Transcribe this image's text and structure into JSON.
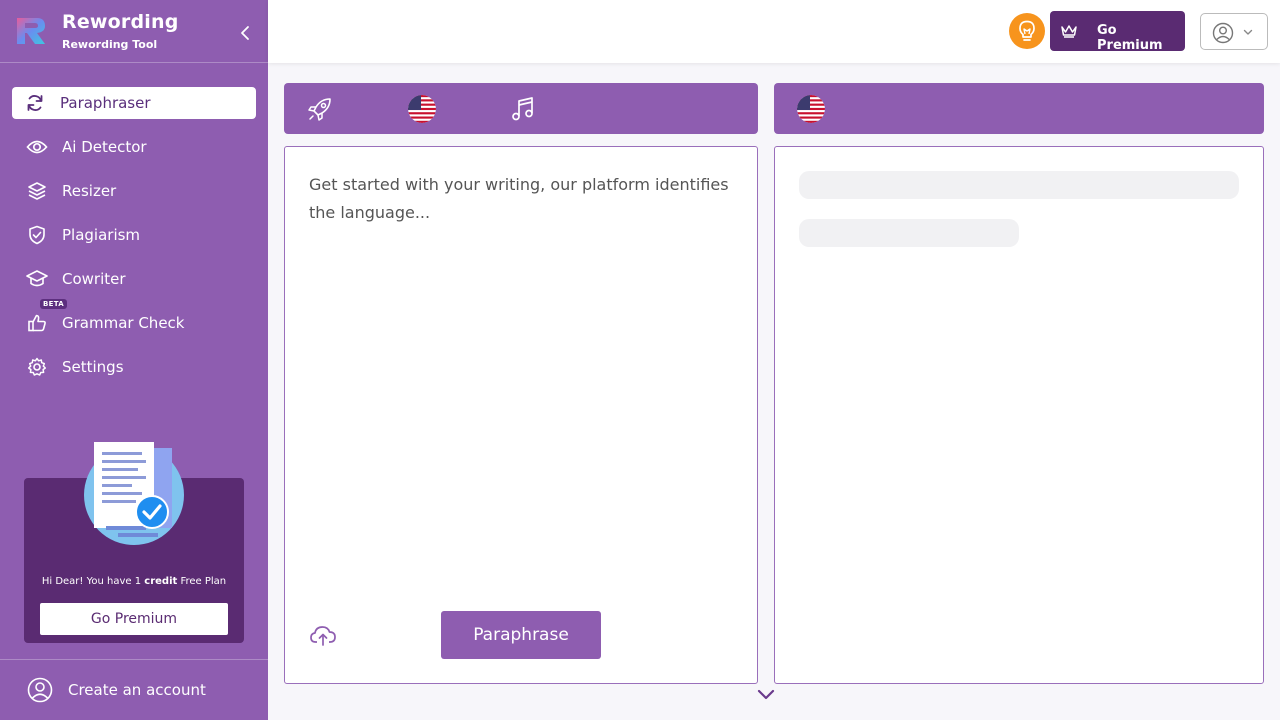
{
  "brand": {
    "title": "Rewording",
    "subtitle": "Rewording Tool"
  },
  "sidebar": {
    "items": [
      {
        "label": "Paraphraser",
        "icon": "refresh-icon",
        "active": true
      },
      {
        "label": "Ai Detector",
        "icon": "eye-icon"
      },
      {
        "label": "Resizer",
        "icon": "layers-icon"
      },
      {
        "label": "Plagiarism",
        "icon": "shield-check-icon"
      },
      {
        "label": "Cowriter",
        "icon": "graduation-cap-icon"
      },
      {
        "label": "Grammar Check",
        "icon": "thumbs-up-icon",
        "badge": "BETA"
      },
      {
        "label": "Settings",
        "icon": "gear-icon"
      }
    ],
    "promo": {
      "message_prefix": "Hi Dear! You have 1 ",
      "message_bold": "credit",
      "message_suffix": " Free Plan",
      "button": "Go Premium"
    },
    "account_label": "Create an account"
  },
  "header": {
    "premium_label": "Go Premium"
  },
  "editor": {
    "placeholder": "Get started with your writing, our platform identifies the language...",
    "paraphrase_button": "Paraphrase"
  },
  "colors": {
    "primary": "#8e5db0",
    "dark": "#5a2b72",
    "accent": "#f7941d"
  }
}
